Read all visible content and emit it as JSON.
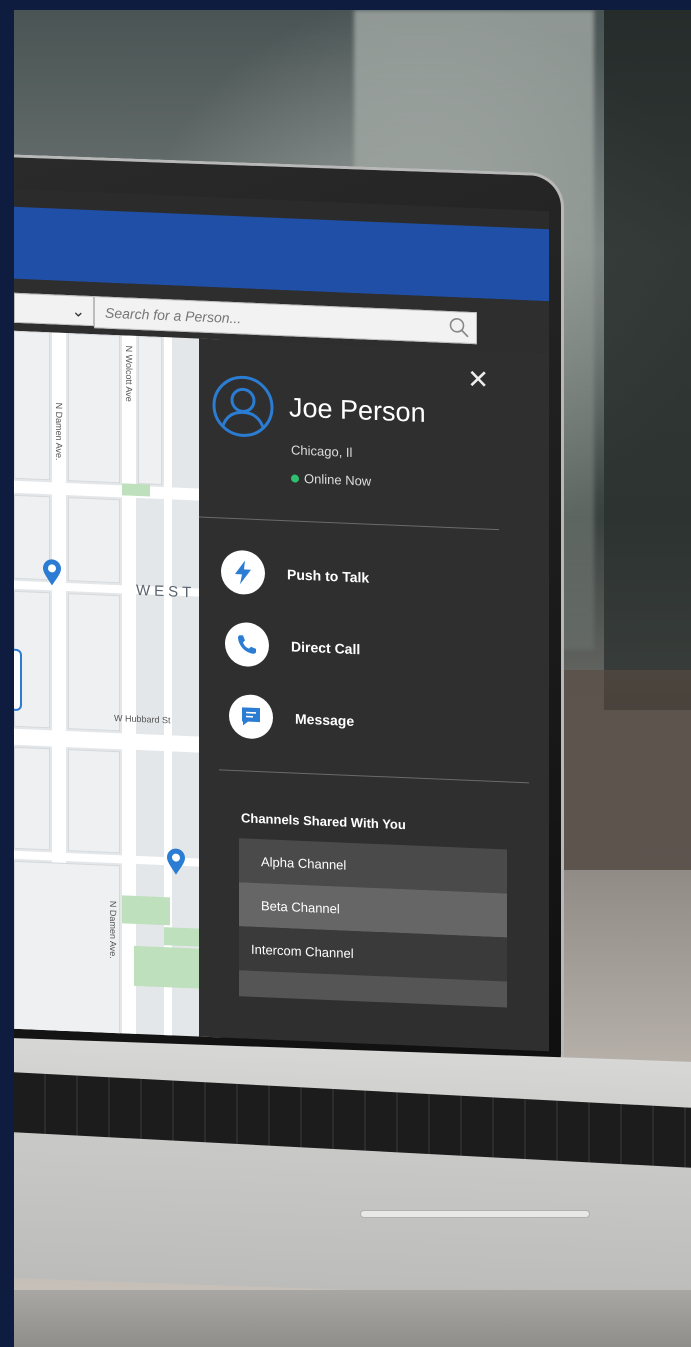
{
  "search": {
    "placeholder": "Search for a Person..."
  },
  "map": {
    "streets": {
      "damen_top": "N Damen Ave.",
      "wolcott": "N Wolcott Ave",
      "hubbard": "W Hubbard St",
      "damen_bottom": "N Damen Ave."
    },
    "district": "WEST T"
  },
  "contact": {
    "name": "Joe Person",
    "location": "Chicago, Il",
    "status": "Online Now",
    "status_color": "#2fbf71"
  },
  "actions": [
    {
      "label": "Push to Talk",
      "icon": "lightning-icon"
    },
    {
      "label": "Direct Call",
      "icon": "phone-icon"
    },
    {
      "label": "Message",
      "icon": "message-icon"
    }
  ],
  "channels": {
    "title": "Channels Shared With You",
    "items": [
      "Alpha Channel",
      "Beta Channel",
      "Intercom Channel"
    ]
  },
  "colors": {
    "brand": "#1f4fa6",
    "accent": "#2b7cd3"
  }
}
